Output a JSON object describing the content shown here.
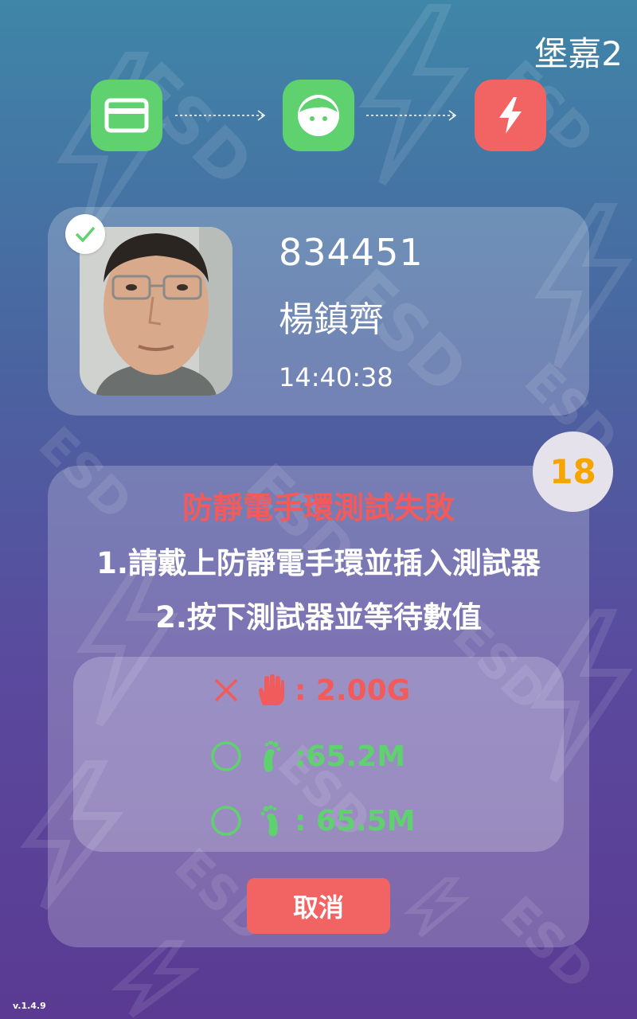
{
  "header": {
    "station_name": "堡嘉2"
  },
  "steps": [
    {
      "name": "card",
      "icon": "card-icon",
      "state": "done",
      "color": "#5fd16f"
    },
    {
      "name": "face",
      "icon": "face-icon",
      "state": "done",
      "color": "#5fd16f"
    },
    {
      "name": "esd",
      "icon": "lightning-icon",
      "state": "failed",
      "color": "#f26464"
    }
  ],
  "user": {
    "employee_id": "834451",
    "name": "楊鎮齊",
    "time": "14:40:38",
    "verified": true
  },
  "result": {
    "countdown": "18",
    "title": "防靜電手環測試失敗",
    "instruction_1": "1.請戴上防靜電手環並插入測試器",
    "instruction_2": "2.按下測試器並等待數值",
    "readings": [
      {
        "status": "fail",
        "status_icon": "cross-icon",
        "body_icon": "hand-icon",
        "value": ": 2.00G",
        "color": "#f25b5b"
      },
      {
        "status": "pass",
        "status_icon": "circle-icon",
        "body_icon": "left-foot-icon",
        "value": ":65.2M",
        "color": "#5fd16f"
      },
      {
        "status": "pass",
        "status_icon": "circle-icon",
        "body_icon": "right-foot-icon",
        "value": ": 65.5M",
        "color": "#5fd16f"
      }
    ],
    "cancel_label": "取消"
  },
  "footer": {
    "version": "v.1.4.9"
  },
  "watermark": "ESD"
}
